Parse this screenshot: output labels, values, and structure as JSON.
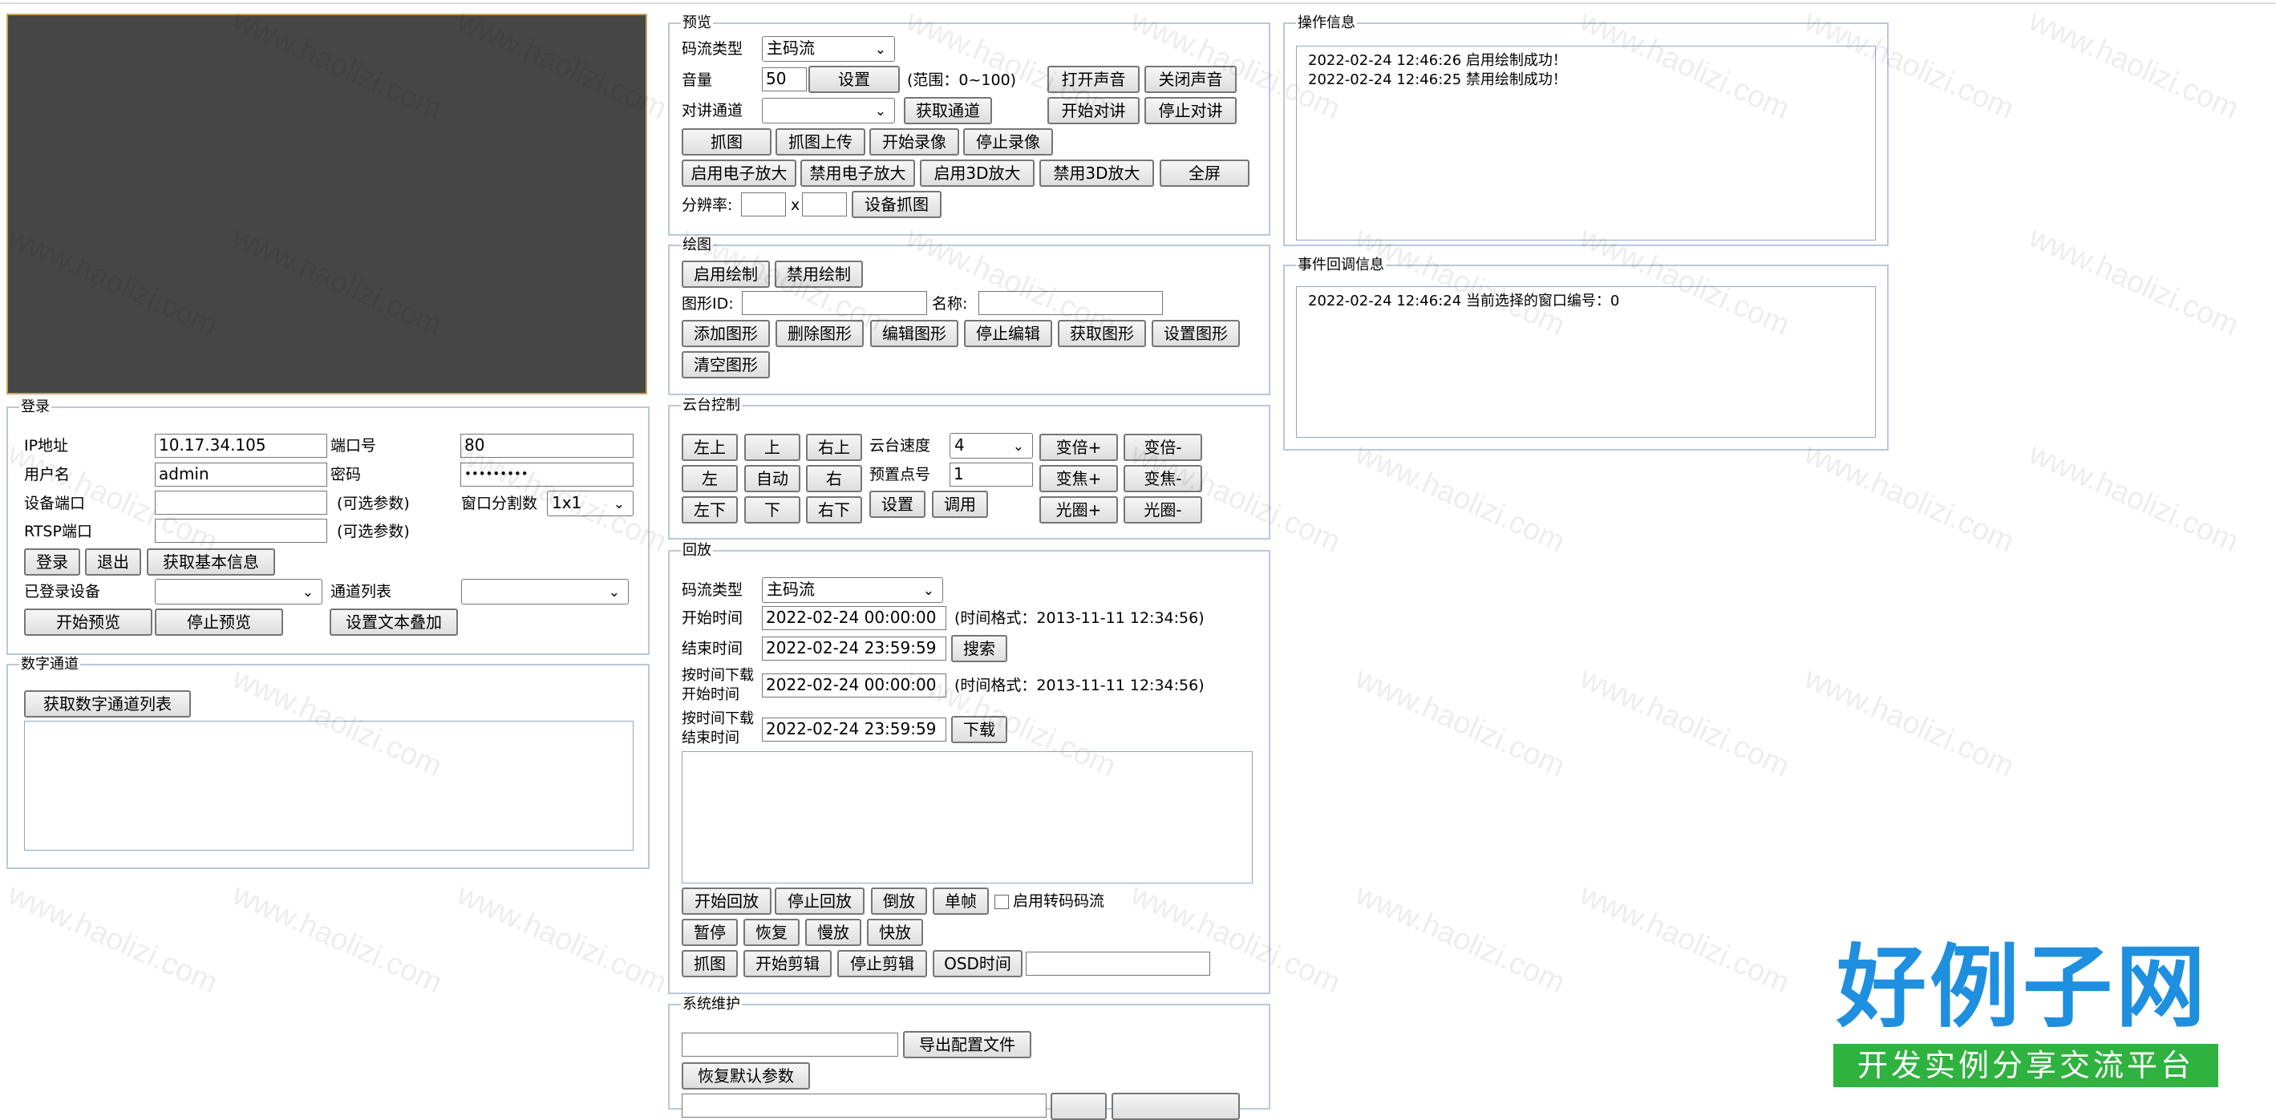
{
  "watermark": "www.haolizi.com",
  "login": {
    "legend": "登录",
    "ip_label": "IP地址",
    "ip_value": "10.17.34.105",
    "port_label": "端口号",
    "port_value": "80",
    "user_label": "用户名",
    "user_value": "admin",
    "pwd_label": "密码",
    "pwd_value": "•••••••••",
    "devport_label": "设备端口",
    "optional1": "(可选参数)",
    "split_label": "窗口分割数",
    "split_value": "1x1",
    "rtsp_label": "RTSP端口",
    "optional2": "(可选参数)",
    "btn_login": "登录",
    "btn_logout": "退出",
    "btn_getinfo": "获取基本信息",
    "logged_label": "已登录设备",
    "channel_label": "通道列表",
    "btn_start_preview": "开始预览",
    "btn_stop_preview": "停止预览",
    "btn_text_overlay": "设置文本叠加"
  },
  "digital": {
    "legend": "数字通道",
    "btn_get_list": "获取数字通道列表"
  },
  "preview": {
    "legend": "预览",
    "stream_label": "码流类型",
    "stream_value": "主码流",
    "volume_label": "音量",
    "volume_value": "50",
    "btn_set": "设置",
    "range_text": "(范围：0~100)",
    "btn_open_sound": "打开声音",
    "btn_close_sound": "关闭声音",
    "talk_label": "对讲通道",
    "btn_get_channel": "获取通道",
    "btn_start_talk": "开始对讲",
    "btn_stop_talk": "停止对讲",
    "btn_capture": "抓图",
    "btn_capture_upload": "抓图上传",
    "btn_start_record": "开始录像",
    "btn_stop_record": "停止录像",
    "btn_ezoom_on": "启用电子放大",
    "btn_ezoom_off": "禁用电子放大",
    "btn_3d_on": "启用3D放大",
    "btn_3d_off": "禁用3D放大",
    "btn_fullscreen": "全屏",
    "resolution_label": "分辨率:",
    "x_sep": "x",
    "btn_device_capture": "设备抓图"
  },
  "draw": {
    "legend": "绘图",
    "btn_enable": "启用绘制",
    "btn_disable": "禁用绘制",
    "shape_id_label": "图形ID:",
    "name_label": "名称:",
    "btn_add": "添加图形",
    "btn_delete": "删除图形",
    "btn_edit": "编辑图形",
    "btn_stop_edit": "停止编辑",
    "btn_get": "获取图形",
    "btn_set": "设置图形",
    "btn_clear": "清空图形"
  },
  "ptz": {
    "legend": "云台控制",
    "btn_ul": "左上",
    "btn_up": "上",
    "btn_ur": "右上",
    "btn_left": "左",
    "btn_auto": "自动",
    "btn_right": "右",
    "btn_dl": "左下",
    "btn_down": "下",
    "btn_dr": "右下",
    "speed_label": "云台速度",
    "speed_value": "4",
    "preset_label": "预置点号",
    "preset_value": "1",
    "btn_set": "设置",
    "btn_call": "调用",
    "btn_zoom_in": "变倍+",
    "btn_zoom_out": "变倍-",
    "btn_focus_in": "变焦+",
    "btn_focus_out": "变焦-",
    "btn_iris_in": "光圈+",
    "btn_iris_out": "光圈-"
  },
  "playback": {
    "legend": "回放",
    "stream_label": "码流类型",
    "stream_value": "主码流",
    "start_label": "开始时间",
    "start_value": "2022-02-24 00:00:00",
    "format_hint1": "(时间格式：2013-11-11 12:34:56)",
    "end_label": "结束时间",
    "end_value": "2022-02-24 23:59:59",
    "btn_search": "搜索",
    "dl_start_label_1": "按时间下载",
    "dl_start_label_2": "开始时间",
    "dl_start_value": "2022-02-24 00:00:00",
    "format_hint2": "(时间格式：2013-11-11 12:34:56)",
    "dl_end_label_1": "按时间下载",
    "dl_end_label_2": "结束时间",
    "dl_end_value": "2022-02-24 23:59:59",
    "btn_download": "下载",
    "btn_start": "开始回放",
    "btn_stop": "停止回放",
    "btn_reverse": "倒放",
    "btn_frame": "单帧",
    "transcode_label": "启用转码码流",
    "btn_pause": "暂停",
    "btn_resume": "恢复",
    "btn_slow": "慢放",
    "btn_fast": "快放",
    "btn_capture": "抓图",
    "btn_start_clip": "开始剪辑",
    "btn_stop_clip": "停止剪辑",
    "btn_osd": "OSD时间"
  },
  "maint": {
    "legend": "系统维护",
    "btn_export": "导出配置文件",
    "btn_restore": "恢复默认参数"
  },
  "oplog": {
    "legend": "操作信息",
    "lines": [
      "2022-02-24 12:46:26 启用绘制成功！",
      "2022-02-24 12:46:25 禁用绘制成功！"
    ]
  },
  "evlog": {
    "legend": "事件回调信息",
    "lines": [
      "2022-02-24 12:46:24 当前选择的窗口编号：0"
    ]
  },
  "brand": {
    "main": "好例子网",
    "sub": "开发实例分享交流平台"
  }
}
